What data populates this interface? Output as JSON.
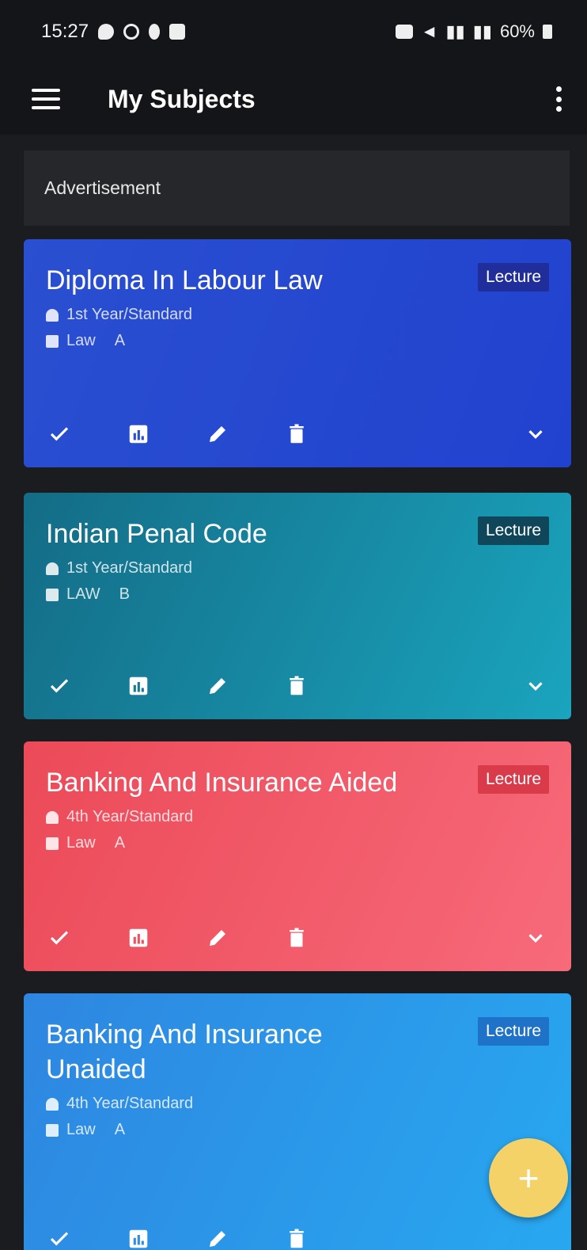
{
  "status": {
    "time": "15:27",
    "battery": "60%"
  },
  "appbar": {
    "title": "My Subjects"
  },
  "ad": {
    "label": "Advertisement"
  },
  "subjects": [
    {
      "name": "Diploma In Labour Law",
      "badge": "Lecture",
      "year": "1st Year/Standard",
      "course": "Law",
      "section": "A"
    },
    {
      "name": "Indian Penal Code",
      "badge": "Lecture",
      "year": "1st Year/Standard",
      "course": "LAW",
      "section": "B"
    },
    {
      "name": "Banking And Insurance Aided",
      "badge": "Lecture",
      "year": "4th Year/Standard",
      "course": "Law",
      "section": "A"
    },
    {
      "name": "Banking And Insurance Unaided",
      "badge": "Lecture",
      "year": "4th Year/Standard",
      "course": "Law",
      "section": "A"
    }
  ],
  "fab": {
    "icon": "add-icon"
  }
}
